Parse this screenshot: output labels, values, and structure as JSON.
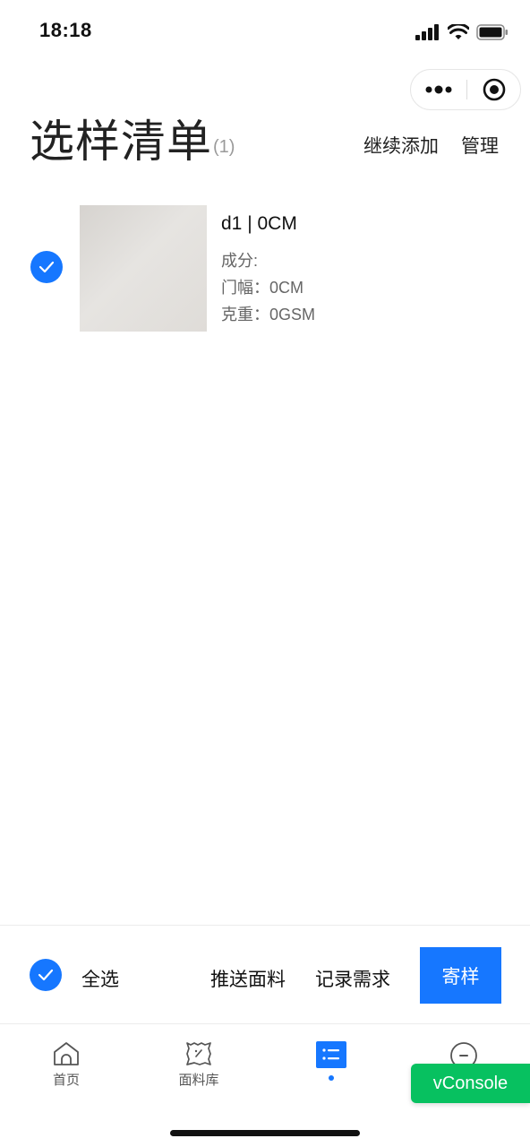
{
  "status_bar": {
    "time": "18:18"
  },
  "capsule": {
    "more_icon": "more-dots-icon",
    "close_icon": "target-circle-icon"
  },
  "header": {
    "title": "选样清单",
    "count": "(1)",
    "continue_add": "继续添加",
    "manage": "管理"
  },
  "items": [
    {
      "name": "d1 | 0CM",
      "composition": "成分:",
      "width": "门幅：0CM",
      "weight": "克重：0GSM",
      "selected": true
    }
  ],
  "action_bar": {
    "select_all": "全选",
    "push_fabric": "推送面料",
    "record_demand": "记录需求",
    "send_sample": "寄样"
  },
  "tabbar": {
    "tabs": [
      {
        "label": "首页",
        "icon": "home-icon",
        "active": false
      },
      {
        "label": "面料库",
        "icon": "fabric-swatch-icon",
        "active": false
      },
      {
        "label": "",
        "icon": "list-icon",
        "active": true
      },
      {
        "label": "",
        "icon": "user-icon",
        "active": false
      }
    ]
  },
  "vconsole": {
    "label": "vConsole"
  },
  "colors": {
    "accent": "#1677ff",
    "vconsole": "#07c160"
  }
}
